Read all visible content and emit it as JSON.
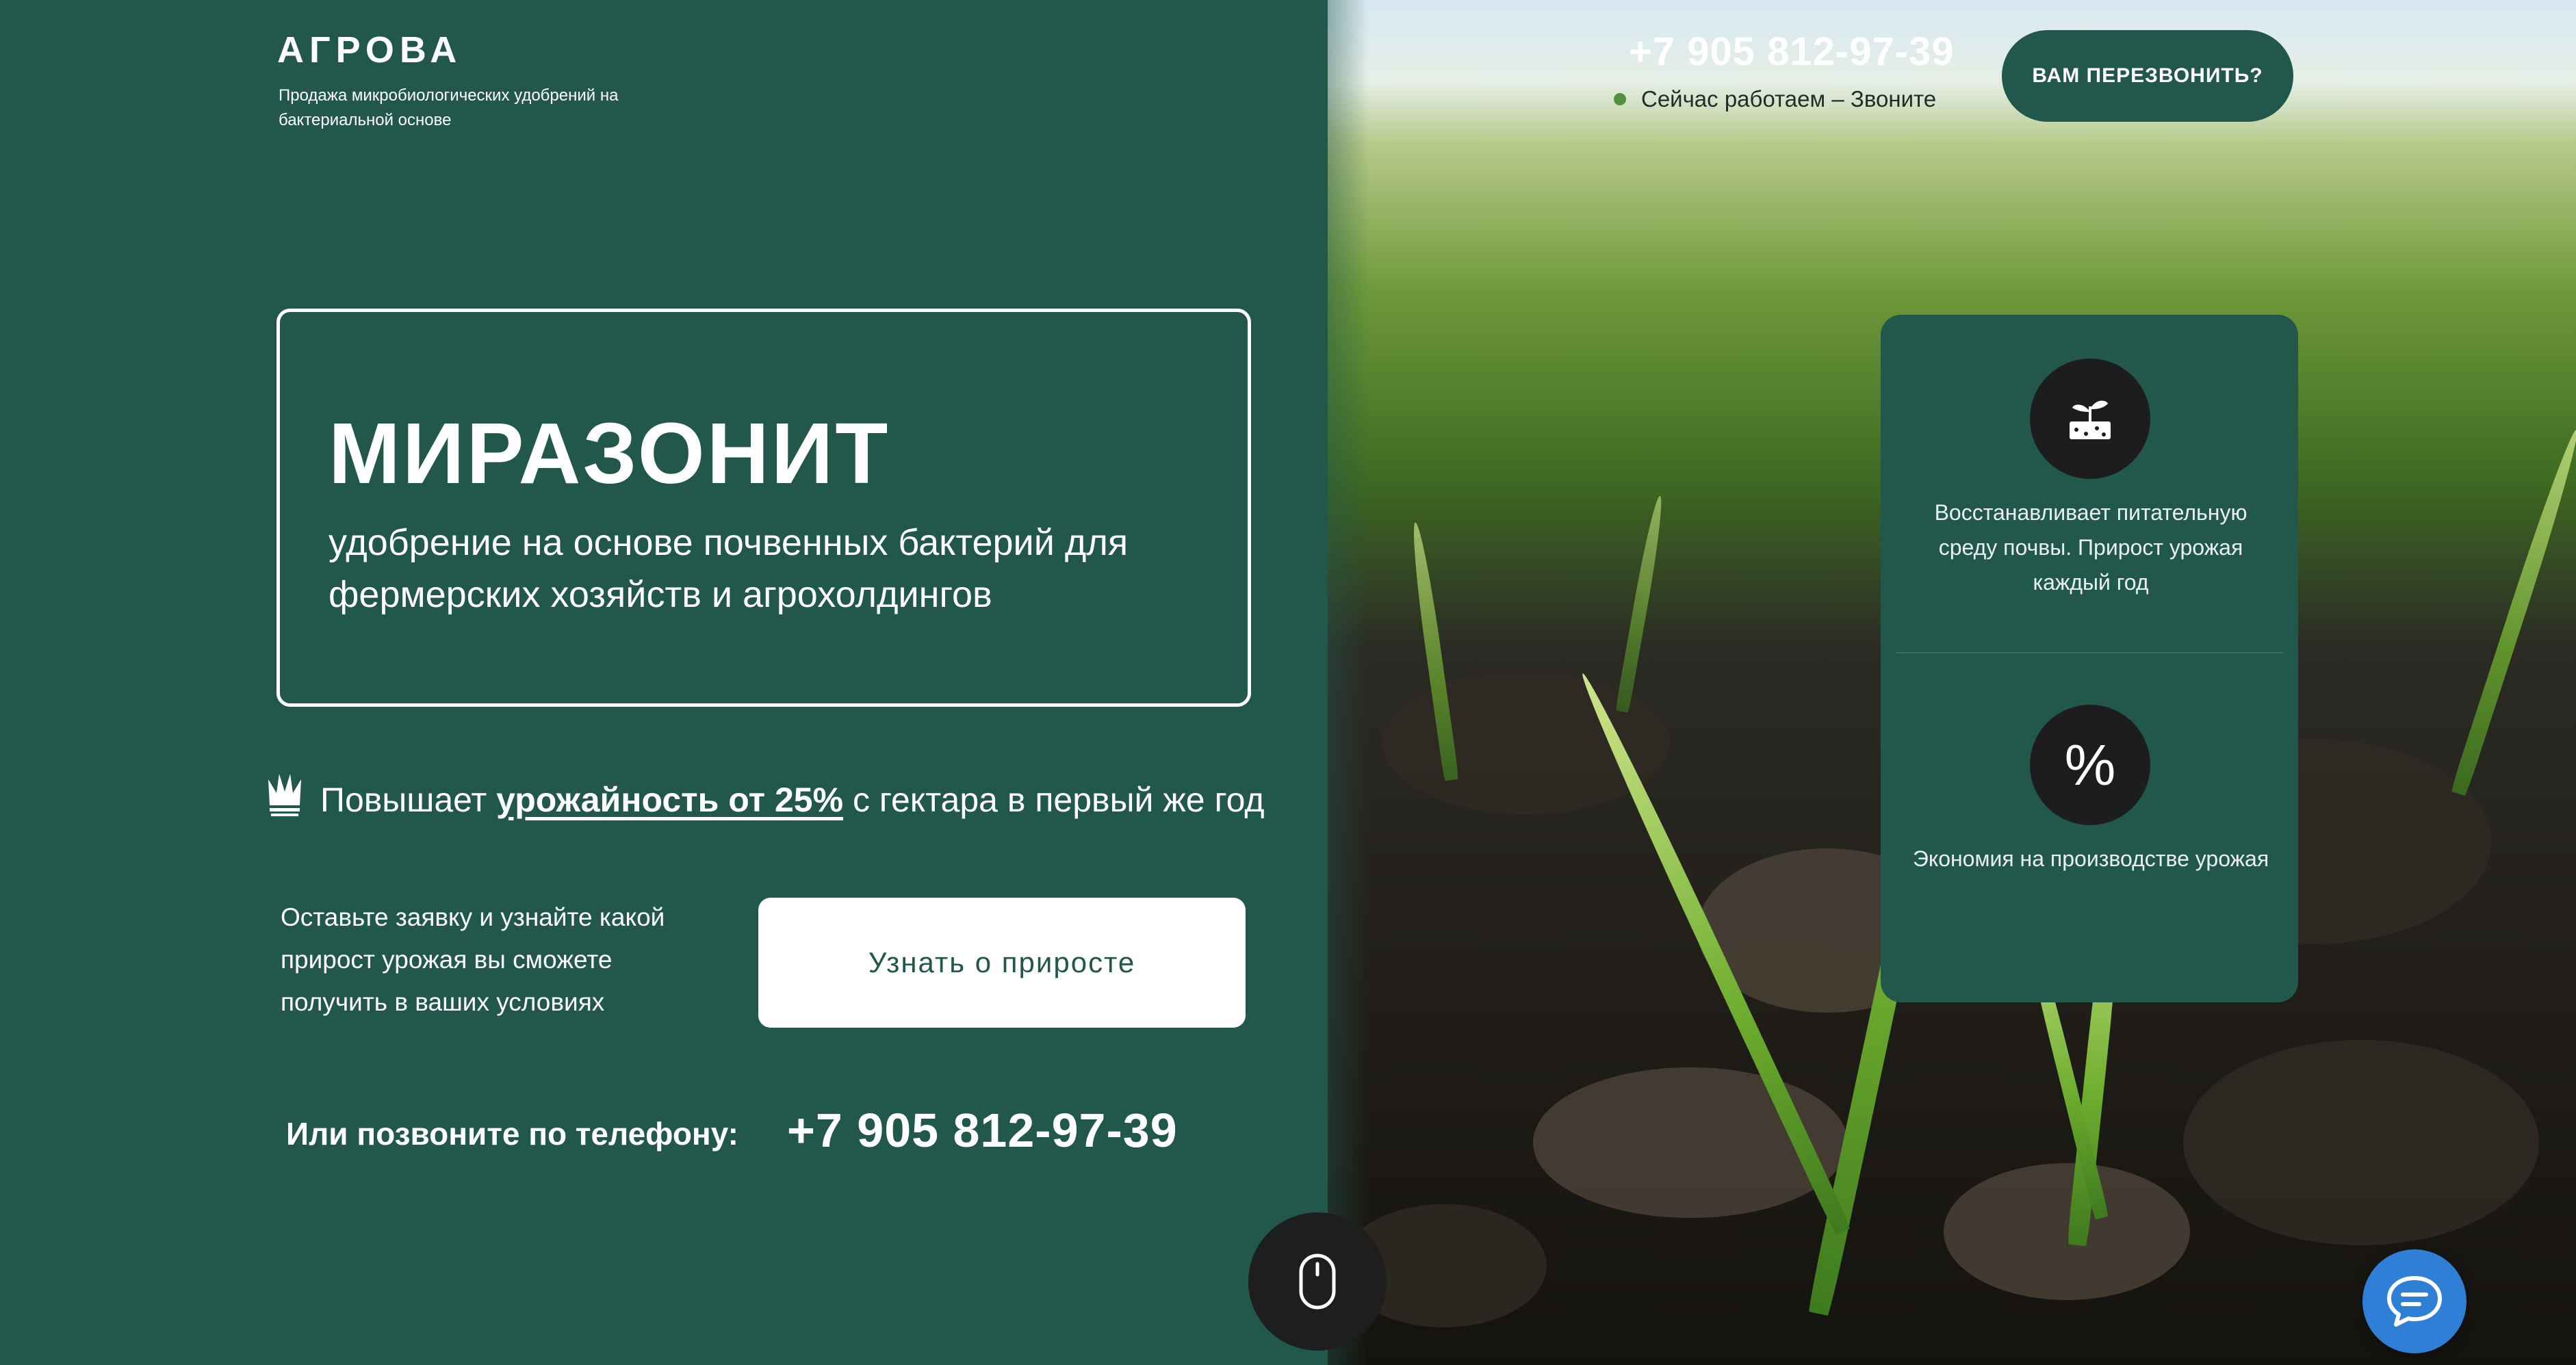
{
  "header": {
    "logo": "АГРОВА",
    "logo_subtitle": "Продажа микробиологических удобрений на бактериальной основе",
    "phone": "+7 905 812-97-39",
    "status": "Сейчас работаем – Звоните",
    "callback_button": "ВАМ ПЕРЕЗВОНИТЬ?"
  },
  "hero": {
    "brand": "МИРАЗОНИТ",
    "description": "удобрение на основе почвенных бактерий для фермерских хозяйств и агрохолдингов"
  },
  "benefit": {
    "prefix": "Повышает ",
    "highlight": "урожайность от 25%",
    "suffix": " с гектара в первый же год"
  },
  "cta": {
    "text": "Оставьте заявку и узнайте какой прирост урожая вы сможете получить в ваших условиях",
    "button": "Узнать о приросте"
  },
  "call": {
    "label": "Или позвоните по телефону:",
    "phone": "+7 905 812-97-39"
  },
  "features": [
    {
      "icon": "sprout-soil-icon",
      "text": "Восстанавливает питательную среду почвы. Прирост урожая каждый год"
    },
    {
      "icon": "percent-icon",
      "text": "Экономия на производстве урожая"
    }
  ],
  "colors": {
    "brand_green": "#22574C",
    "status_dot": "#53913f",
    "chat_blue": "#2f7fd6"
  }
}
